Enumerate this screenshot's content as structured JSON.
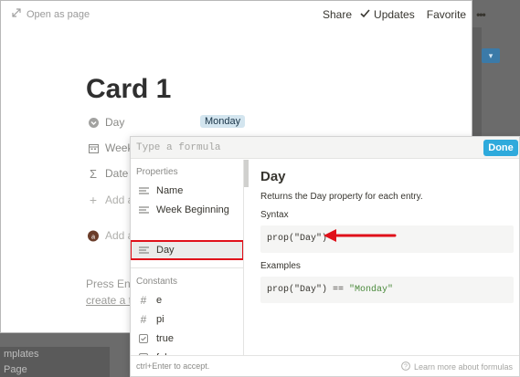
{
  "topbar": {
    "open_as_page": "Open as page",
    "share": "Share",
    "updates": "Updates",
    "favorite": "Favorite",
    "more": "•••"
  },
  "card": {
    "title": "Card 1",
    "properties": [
      {
        "label": "Day",
        "icon": "formula-circle-icon"
      },
      {
        "label": "Week",
        "icon": "calendar-icon"
      },
      {
        "label": "Date",
        "icon": "sigma-icon"
      },
      {
        "label": "Add a",
        "icon": "plus-icon"
      }
    ],
    "day_value": "Monday",
    "comment_placeholder": "Add a",
    "press_enter": "Press Ente",
    "create_link": "create a t"
  },
  "background": {
    "sidebar_line1": "mplates",
    "sidebar_line2": "Page"
  },
  "formula_editor": {
    "placeholder": "Type a formula",
    "done_label": "Done",
    "sections": {
      "properties_label": "Properties",
      "constants_label": "Constants"
    },
    "properties": [
      {
        "label": "Name",
        "icon": "text-lines-icon"
      },
      {
        "label": "Week Beginning",
        "icon": "text-lines-icon"
      },
      {
        "label": "Day",
        "icon": "text-lines-icon",
        "selected": true
      }
    ],
    "constants": [
      {
        "label": "e",
        "icon": "hash-icon"
      },
      {
        "label": "pi",
        "icon": "hash-icon"
      },
      {
        "label": "true",
        "icon": "checkbox-icon"
      },
      {
        "label": "false",
        "icon": "checkbox-icon"
      }
    ],
    "detail": {
      "title": "Day",
      "description": "Returns the Day property for each entry.",
      "syntax_label": "Syntax",
      "syntax_code_fn": "prop(",
      "syntax_code_arg": "\"Day\"",
      "syntax_code_end": ")",
      "examples_label": "Examples",
      "example_fn": "prop(",
      "example_arg": "\"Day\"",
      "example_mid": ") == ",
      "example_value": "\"Monday\""
    },
    "footer_hint": "ctrl+Enter to accept.",
    "footer_learn": "Learn more about formulas"
  },
  "colors": {
    "accent": "#2eaadc",
    "highlight_red": "#e0101a",
    "string_green": "#4b8a3c"
  }
}
